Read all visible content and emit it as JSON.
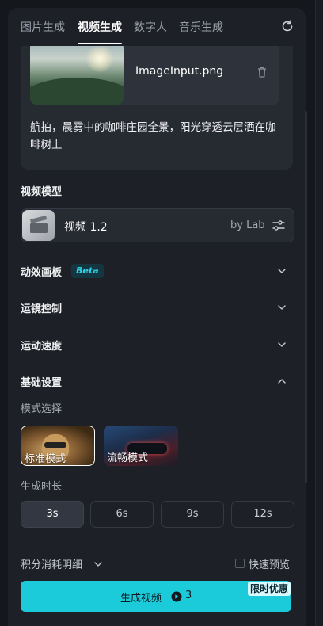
{
  "tabs": [
    {
      "label": "图片生成"
    },
    {
      "label": "视频生成",
      "active": true
    },
    {
      "label": "数字人"
    },
    {
      "label": "音乐生成"
    }
  ],
  "upload": {
    "file_name": "ImageInput.png"
  },
  "prompt": {
    "text": "航拍，晨雾中的咖啡庄园全景，阳光穿透云层洒在咖啡树上"
  },
  "model_section": {
    "label": "视频模型",
    "model_name": "视频 1.2",
    "provider": "by Lab"
  },
  "sections": {
    "motion_canvas": {
      "label": "动效画板",
      "badge": "Beta"
    },
    "camera_control": {
      "label": "运镜控制"
    },
    "motion_speed": {
      "label": "运动速度"
    },
    "basic_settings": {
      "label": "基础设置"
    }
  },
  "mode": {
    "label": "模式选择",
    "options": [
      {
        "label": "标准模式",
        "selected": true
      },
      {
        "label": "流畅模式",
        "selected": false
      }
    ]
  },
  "duration": {
    "label": "生成时长",
    "options": [
      "3s",
      "6s",
      "9s",
      "12s"
    ],
    "selected": "3s"
  },
  "footer": {
    "points_label": "积分消耗明细",
    "preview_label": "快速预览",
    "preview_checked": false,
    "generate_label": "生成视频",
    "cost": "3",
    "promo": "限时优惠"
  },
  "colors": {
    "accent": "#1ccbd9",
    "panel": "#1d2026",
    "card": "#262a31"
  }
}
